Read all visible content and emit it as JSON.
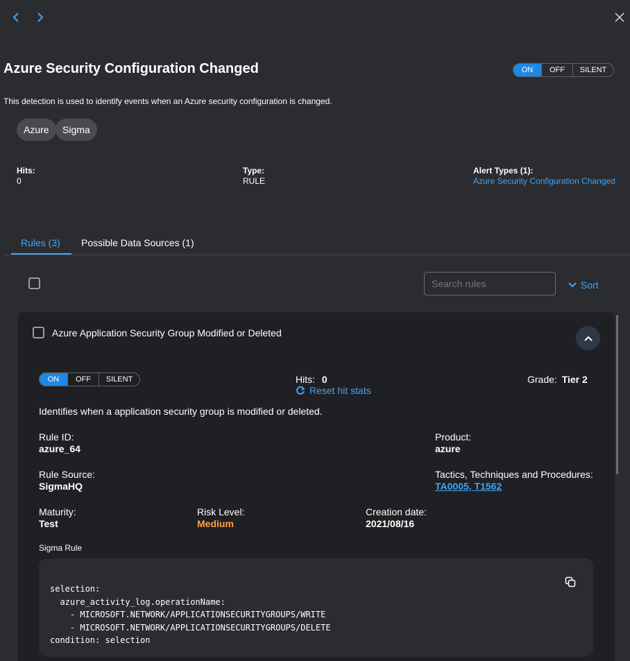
{
  "header": {
    "back_icon": "chevron-left-icon",
    "forward_icon": "chevron-right-icon",
    "close_icon": "close-icon",
    "title": "Azure Security Configuration Changed",
    "description": "This detection is used to identify events when an Azure security configuration is changed.",
    "toggle": {
      "options": [
        "ON",
        "OFF",
        "SILENT"
      ],
      "selected": "ON"
    }
  },
  "tags": [
    "Azure",
    "Sigma"
  ],
  "stats": {
    "hits_label": "Hits:",
    "hits_value": "0",
    "type_label": "Type:",
    "type_value": "RULE",
    "alert_types_label": "Alert Types (1):",
    "alert_types_value": "Azure Security Configuration Changed"
  },
  "tabs": [
    {
      "label": "Rules (3)",
      "active": true
    },
    {
      "label": "Possible Data Sources (1)",
      "active": false
    }
  ],
  "toolbar": {
    "search_placeholder": "Search rules",
    "sort_label": "Sort"
  },
  "rule": {
    "title": "Azure Application Security Group Modified or Deleted",
    "toggle": {
      "options": [
        "ON",
        "OFF",
        "SILENT"
      ],
      "selected": "ON"
    },
    "hits_label": "Hits:",
    "hits_value": "0",
    "reset_label": "Reset hit stats",
    "grade_label": "Grade:",
    "grade_value": "Tier 2",
    "description": "Identifies when a application security group is modified or deleted.",
    "rule_id_label": "Rule ID:",
    "rule_id_value": "azure_64",
    "product_label": "Product:",
    "product_value": "azure",
    "rule_source_label": "Rule Source:",
    "rule_source_value": "SigmaHQ",
    "ttp_label": "Tactics, Techniques and Procedures:",
    "ttp_value": "TA0005, T1562",
    "maturity_label": "Maturity:",
    "maturity_value": "Test",
    "risk_label": "Risk Level:",
    "risk_value": "Medium",
    "creation_label": "Creation date:",
    "creation_value": "2021/08/16",
    "sigma_label": "Sigma Rule",
    "sigma_code": "selection:\n  azure_activity_log.operationName:\n    - MICROSOFT.NETWORK/APPLICATIONSECURITYGROUPS/WRITE\n    - MICROSOFT.NETWORK/APPLICATIONSECURITYGROUPS/DELETE\ncondition: selection"
  },
  "colors": {
    "background": "#2b2c30",
    "card": "#1f2023",
    "code_block": "#2b2c30",
    "accent": "#1e88e5",
    "link": "#42a5f5",
    "risk_medium": "#ffa040"
  }
}
